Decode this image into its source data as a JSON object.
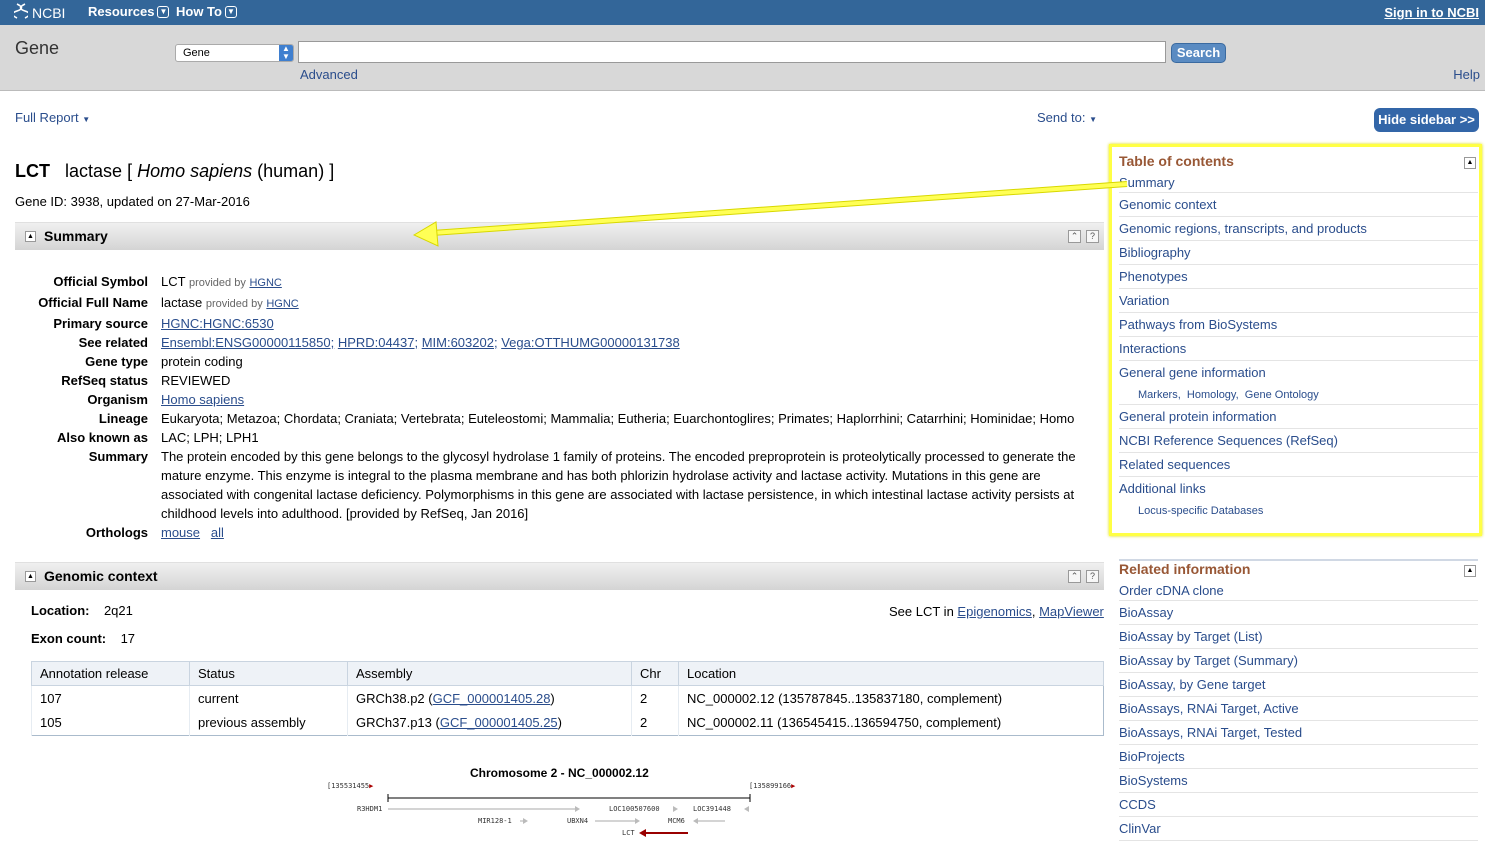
{
  "topbar": {
    "logo_text": "NCBI",
    "menus": [
      "Resources",
      "How To"
    ],
    "signin": "Sign in to NCBI"
  },
  "search": {
    "db_name": "Gene",
    "db_selected": "Gene",
    "term_value": "",
    "button": "Search",
    "advanced": "Advanced",
    "help": "Help"
  },
  "toolbar": {
    "full_report": "Full Report",
    "send_to": "Send to:",
    "hide_sidebar": "Hide sidebar >>"
  },
  "gene": {
    "symbol": "LCT",
    "name": "lactase",
    "organism_italic": "Homo sapiens",
    "organism_common": "(human)",
    "gene_id_line": "Gene ID: 3938, updated on 27-Mar-2016"
  },
  "summary_section": {
    "title": "Summary",
    "official_symbol_label": "Official Symbol",
    "official_symbol": "LCT",
    "provided_by": "provided by",
    "hgnc": "HGNC",
    "official_full_name_label": "Official Full Name",
    "official_full_name": "lactase",
    "primary_source_label": "Primary source",
    "primary_source": "HGNC:HGNC:6530",
    "see_related_label": "See related",
    "see_related": [
      "Ensembl:ENSG00000115850;",
      "HPRD:04437;",
      "MIM:603202;",
      "Vega:OTTHUMG00000131738"
    ],
    "gene_type_label": "Gene type",
    "gene_type": "protein coding",
    "refseq_status_label": "RefSeq status",
    "refseq_status": "REVIEWED",
    "organism_label": "Organism",
    "organism": "Homo sapiens",
    "lineage_label": "Lineage",
    "lineage": "Eukaryota; Metazoa; Chordata; Craniata; Vertebrata; Euteleostomi; Mammalia; Eutheria; Euarchontoglires; Primates; Haplorrhini; Catarrhini; Hominidae; Homo",
    "aka_label": "Also known as",
    "aka": "LAC; LPH; LPH1",
    "summary_label": "Summary",
    "summary_text": "The protein encoded by this gene belongs to the glycosyl hydrolase 1 family of proteins. The encoded preproprotein is proteolytically processed to generate the mature enzyme. This enzyme is integral to the plasma membrane and has both phlorizin hydrolase activity and lactase activity. Mutations in this gene are associated with congenital lactase deficiency. Polymorphisms in this gene are associated with lactase persistence, in which intestinal lactase activity persists at childhood levels into adulthood. [provided by RefSeq, Jan 2016]",
    "orthologs_label": "Orthologs",
    "orthologs": [
      "mouse",
      "all"
    ]
  },
  "genomic_section": {
    "title": "Genomic context",
    "location_label": "Location:",
    "location": "2q21",
    "exon_label": "Exon count:",
    "exon_count": "17",
    "see_in": "See LCT in",
    "see_links": [
      "Epigenomics",
      "MapViewer"
    ],
    "table_headers": [
      "Annotation release",
      "Status",
      "Assembly",
      "Chr",
      "Location"
    ],
    "table_rows": [
      {
        "release": "107",
        "status": "current",
        "asm": "GRCh38.p2",
        "asm_link": "GCF_000001405.28",
        "chr": "2",
        "location": "NC_000002.12 (135787845..135837180, complement)"
      },
      {
        "release": "105",
        "status": "previous assembly",
        "asm": "GRCh37.p13",
        "asm_link": "GCF_000001405.25",
        "chr": "2",
        "location": "NC_000002.11 (136545415..136594750, complement)"
      }
    ],
    "chrom_title": "Chromosome 2 - NC_000002.12",
    "chrom_left": "135531455",
    "chrom_right": "135899166",
    "genes": [
      "R3HDM1",
      "LOC100507600",
      "LOC391448",
      "MIR128-1",
      "UBXN4",
      "MCM6",
      "LCT"
    ]
  },
  "toc": {
    "title": "Table of contents",
    "items": [
      "Summary",
      "Genomic context",
      "Genomic regions, transcripts, and products",
      "Bibliography",
      "Phenotypes",
      "Variation",
      "Pathways from BioSystems",
      "Interactions",
      "General gene information"
    ],
    "gene_info_sub": [
      "Markers,",
      "Homology,",
      "Gene Ontology"
    ],
    "items2": [
      "General protein information",
      "NCBI Reference Sequences (RefSeq)",
      "Related sequences",
      "Additional links"
    ],
    "additional_sub": "Locus-specific Databases"
  },
  "related": {
    "title": "Related information",
    "items": [
      "Order cDNA clone",
      "BioAssay",
      "BioAssay by Target (List)",
      "BioAssay by Target (Summary)",
      "BioAssay, by Gene target",
      "BioAssays, RNAi Target, Active",
      "BioAssays, RNAi Target, Tested",
      "BioProjects",
      "BioSystems",
      "CCDS",
      "ClinVar"
    ]
  },
  "colors": {
    "header": "#336699",
    "link": "#2a4d8c",
    "portlet_title": "#985735",
    "highlight": "#ffff44"
  }
}
